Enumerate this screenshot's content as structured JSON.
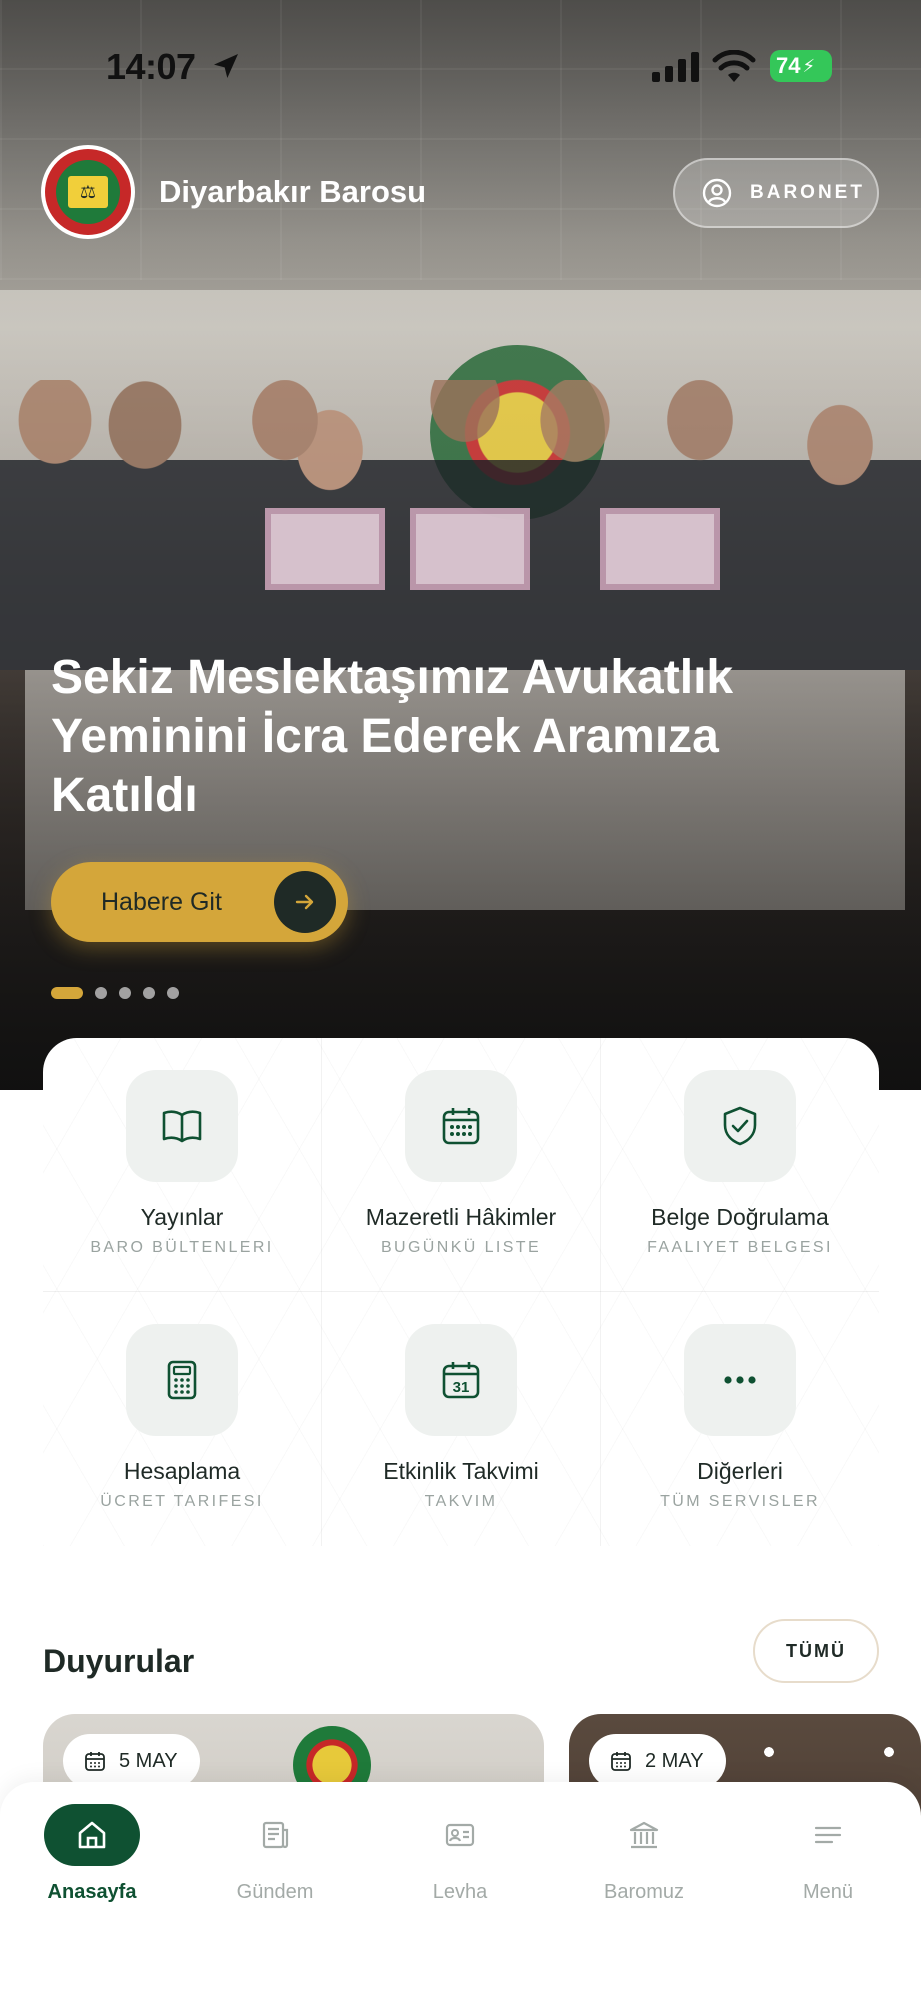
{
  "status_bar": {
    "time": "14:07",
    "battery": "74"
  },
  "header": {
    "title": "Diyarbakır Barosu",
    "baronet_label": "BARONET"
  },
  "hero": {
    "title": "Sekiz Meslektaşımız Avukatlık Yeminini İcra Ederek Aramıza Katıldı",
    "button_label": "Habere Git",
    "slide_count": 5,
    "active_slide": 1
  },
  "services": [
    {
      "title": "Yayınlar",
      "subtitle": "BARO BÜLTENLERI",
      "icon": "book-icon"
    },
    {
      "title": "Mazeretli Hâkimler",
      "subtitle": "BUGÜNKÜ LISTE",
      "icon": "calendar-grid-icon"
    },
    {
      "title": "Belge Doğrulama",
      "subtitle": "FAALIYET BELGESI",
      "icon": "shield-check-icon"
    },
    {
      "title": "Hesaplama",
      "subtitle": "ÜCRET TARIFESI",
      "icon": "calculator-icon"
    },
    {
      "title": "Etkinlik Takvimi",
      "subtitle": "TAKVIM",
      "icon": "calendar-31-icon"
    },
    {
      "title": "Diğerleri",
      "subtitle": "TÜM SERVISLER",
      "icon": "more-dots-icon"
    }
  ],
  "calendar_day": "31",
  "announcements": {
    "title": "Duyurular",
    "all_label": "TÜMÜ",
    "cards": [
      {
        "date": "5 MAY"
      },
      {
        "date": "2 MAY"
      }
    ]
  },
  "nav": [
    {
      "label": "Anasayfa",
      "icon": "home-icon",
      "active": true
    },
    {
      "label": "Gündem",
      "icon": "newspaper-icon",
      "active": false
    },
    {
      "label": "Levha",
      "icon": "id-card-icon",
      "active": false
    },
    {
      "label": "Baromuz",
      "icon": "bank-icon",
      "active": false
    },
    {
      "label": "Menü",
      "icon": "menu-icon",
      "active": false
    }
  ],
  "colors": {
    "primary_green": "#0f5132",
    "accent_gold": "#d4a63a",
    "battery_green": "#34c759"
  }
}
